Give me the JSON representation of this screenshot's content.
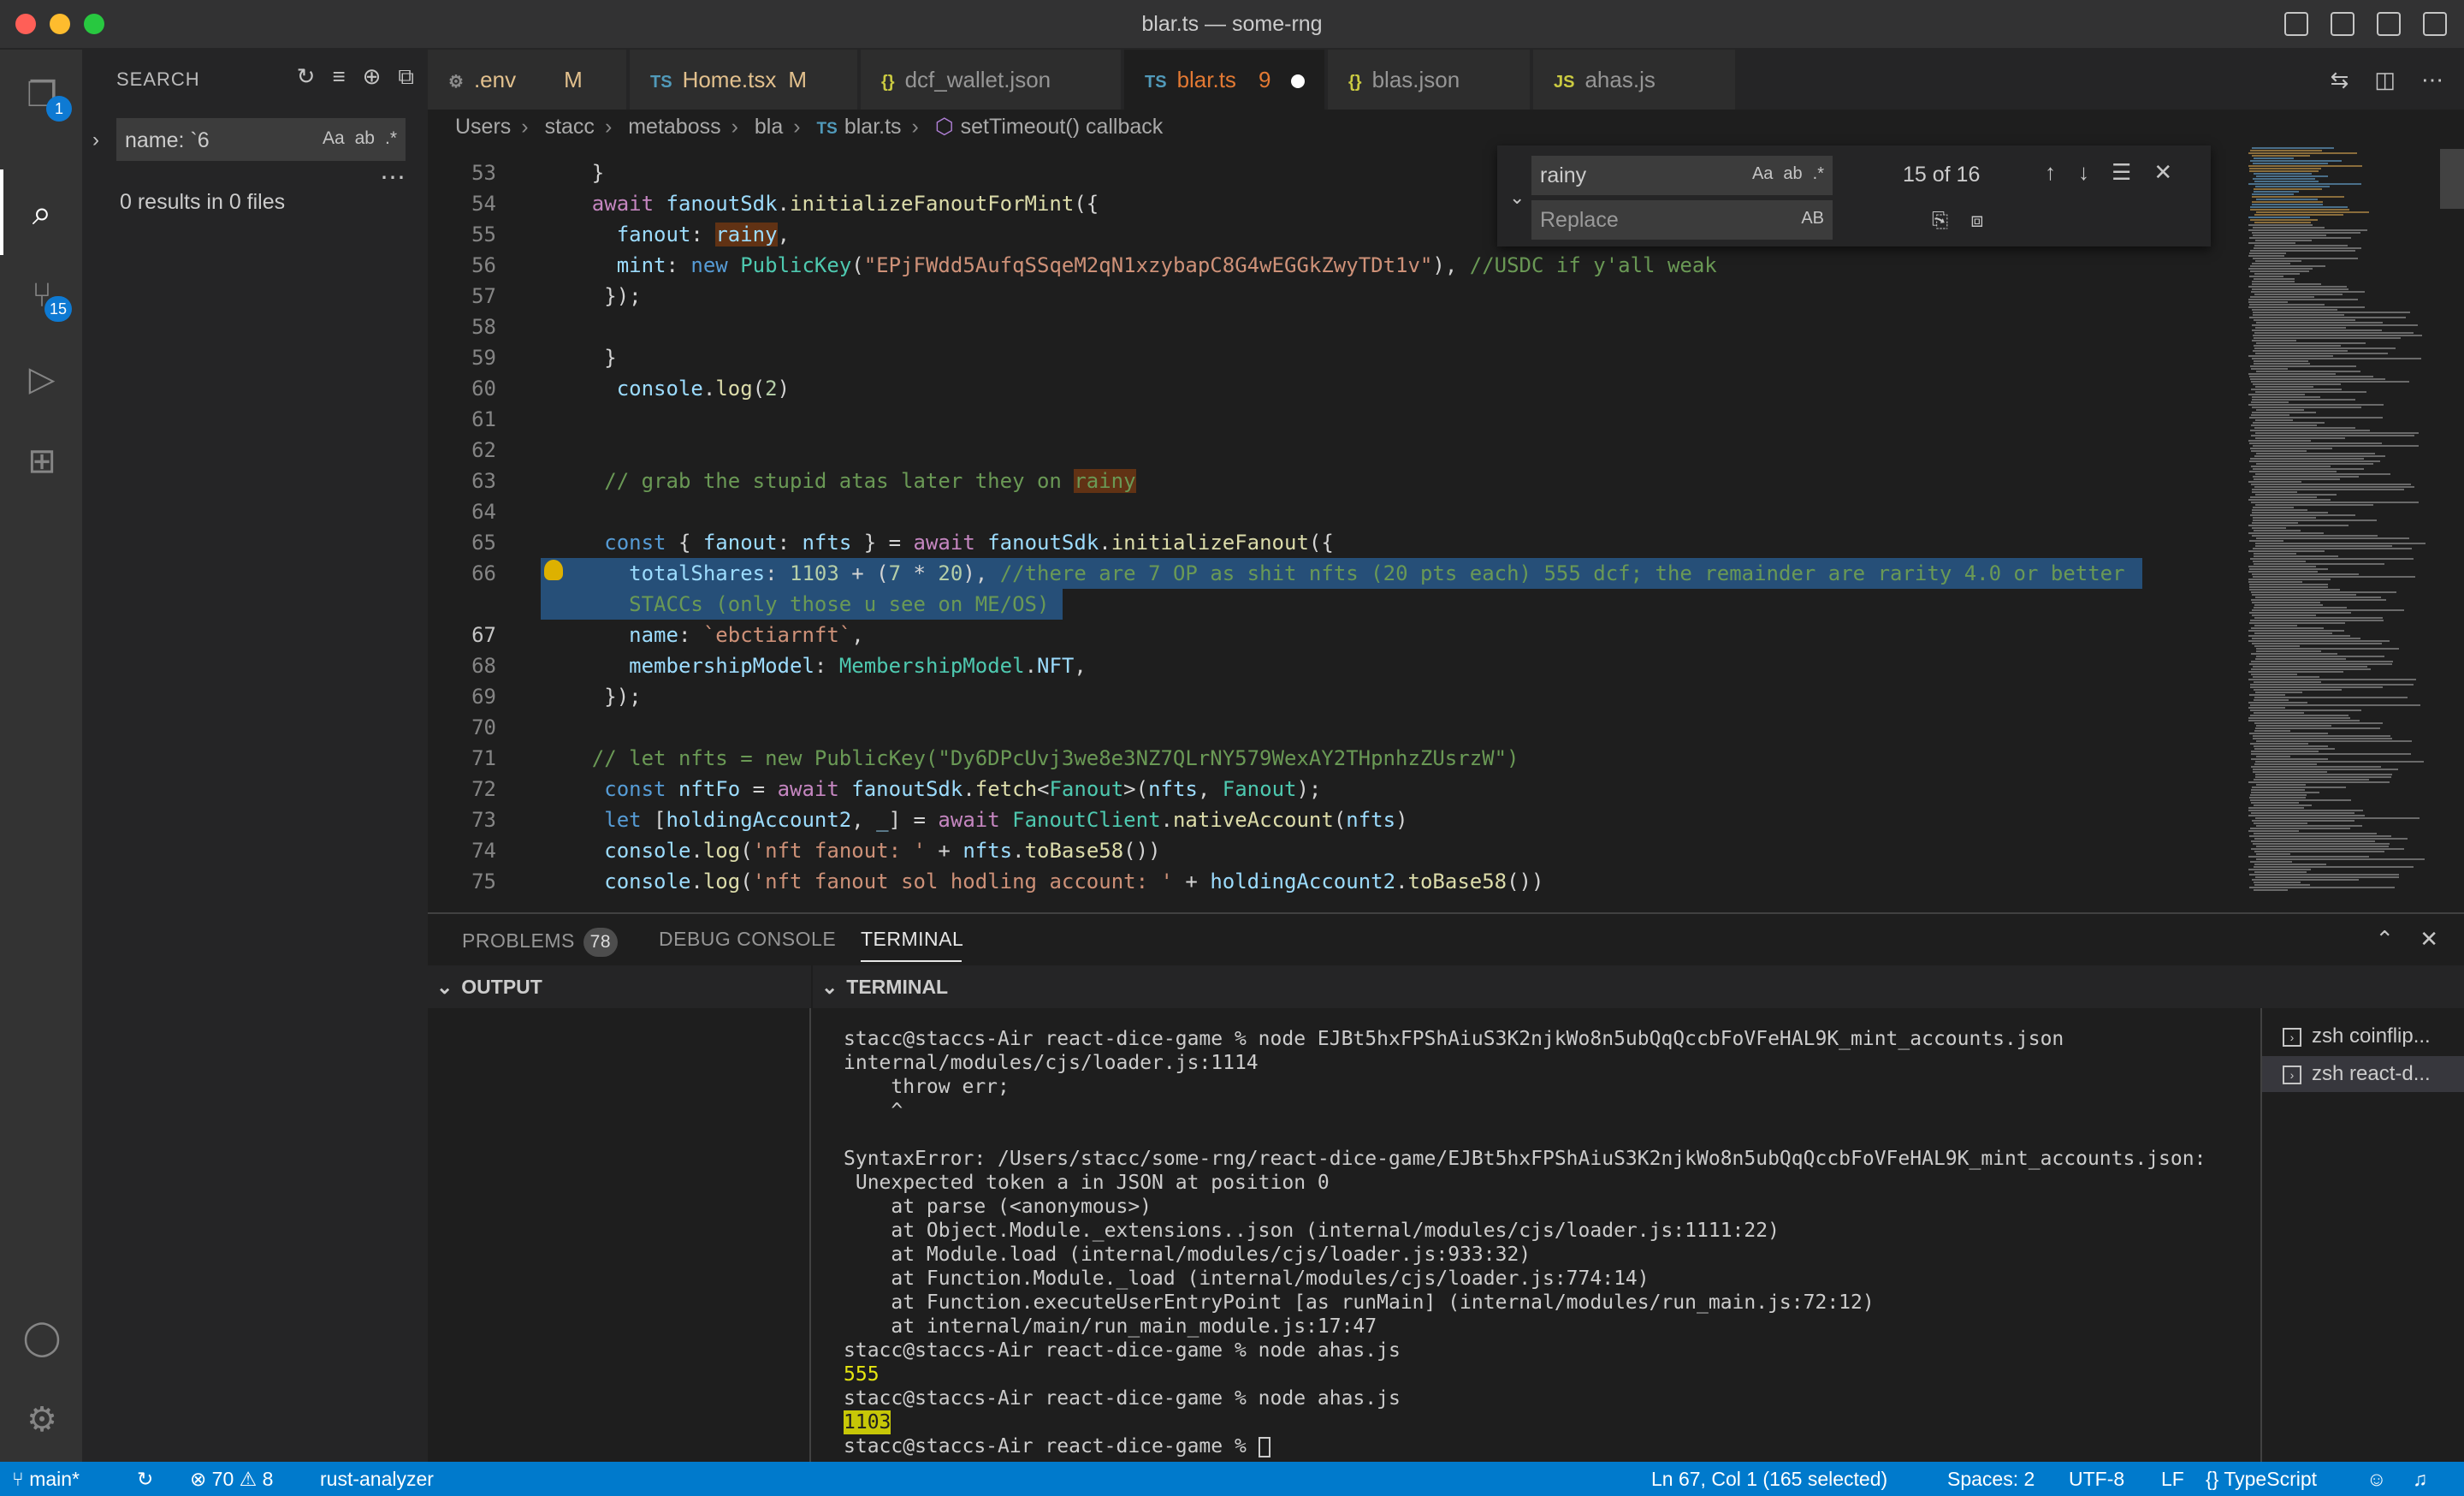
{
  "window": {
    "title": "blar.ts — some-rng"
  },
  "activity": {
    "explorer_badge": "1",
    "scm_badge": "15"
  },
  "sidebar": {
    "title": "SEARCH",
    "search_value": "name: `6",
    "opt_case": "Aa",
    "opt_word": "ab",
    "opt_regex": ".*",
    "results": "0 results in 0 files"
  },
  "tabs": [
    {
      "icon": "⚙",
      "label": ".env",
      "marker": "M",
      "color": "#e2c08d"
    },
    {
      "icon": "TS",
      "label": "Home.tsx",
      "marker": "M",
      "color": "#e2c08d"
    },
    {
      "icon": "{}",
      "label": "dcf_wallet.json",
      "marker": "",
      "color": "#969696"
    },
    {
      "icon": "TS",
      "label": "blar.ts",
      "marker": "9",
      "color": "#e37933"
    },
    {
      "icon": "{}",
      "label": "blas.json",
      "marker": "",
      "color": "#969696"
    },
    {
      "icon": "JS",
      "label": "ahas.js",
      "marker": "",
      "color": "#969696"
    }
  ],
  "breadcrumb": [
    "Users",
    "stacc",
    "metaboss",
    "bla",
    "blar.ts",
    "setTimeout() callback"
  ],
  "find": {
    "search": "rainy",
    "count": "15 of 16",
    "replace_placeholder": "Replace",
    "opt_case": "Aa",
    "opt_word": "ab",
    "opt_regex": ".*",
    "opt_preserve": "AB"
  },
  "code_lines": [
    {
      "n": "53",
      "h": "    }"
    },
    {
      "n": "54",
      "h": "    <span class=\"kw2\">await</span> <span class=\"var\">fanoutSdk</span>.<span class=\"fn\">initializeFanoutForMint</span>({"
    },
    {
      "n": "55",
      "h": "      <span class=\"var\">fanout</span>: <span class=\"var hl\">rainy</span>,"
    },
    {
      "n": "56",
      "h": "      <span class=\"var\">mint</span>: <span class=\"kw\">new</span> <span class=\"cls\">PublicKey</span>(<span class=\"str\">\"EPjFWdd5AufqSSqeM2qN1xzybapC8G4wEGGkZwyTDt1v\"</span>), <span class=\"cm\">//USDC if y'all weak</span>"
    },
    {
      "n": "57",
      "h": "     });"
    },
    {
      "n": "58",
      "h": ""
    },
    {
      "n": "59",
      "h": "     }"
    },
    {
      "n": "60",
      "h": "      <span class=\"var\">console</span>.<span class=\"fn\">log</span>(<span class=\"num\">2</span>)"
    },
    {
      "n": "61",
      "h": ""
    },
    {
      "n": "62",
      "h": ""
    },
    {
      "n": "63",
      "h": "     <span class=\"cm\">// grab the stupid atas later they on </span><span class=\"cm hl\">rainy</span>"
    },
    {
      "n": "64",
      "h": ""
    },
    {
      "n": "65",
      "h": "     <span class=\"kw\">const</span> { <span class=\"var\">fanout</span>: <span class=\"var\">nfts</span> } = <span class=\"kw2\">await</span> <span class=\"var\">fanoutSdk</span>.<span class=\"fn\">initializeFanout</span>({"
    },
    {
      "n": "66",
      "h": "       <span class=\"var\">totalShares</span>: <span class=\"num\">1103</span> + (<span class=\"num\">7</span> * <span class=\"num\">20</span>), <span class=\"cm\">//there are 7 OP as shit nfts (20 pts each) 555 dcf; the remainder are rarity 4.0 or better</span>"
    },
    {
      "n": "",
      "h": "       <span class=\"cm\">STACCs (only those u see on ME/OS)</span>"
    },
    {
      "n": "67",
      "h": "       <span class=\"var\">name</span>: <span class=\"str\">`ebctiarnft`</span>,"
    },
    {
      "n": "68",
      "h": "       <span class=\"var\">membershipModel</span>: <span class=\"cls\">MembershipModel</span>.<span class=\"var\">NFT</span>,"
    },
    {
      "n": "69",
      "h": "     });"
    },
    {
      "n": "70",
      "h": ""
    },
    {
      "n": "71",
      "h": "    <span class=\"cm\">// let nfts = new PublicKey(\"Dy6DPcUvj3we8e3NZ7QLrNY579WexAY2THpnhzZUsrzW\")</span>"
    },
    {
      "n": "72",
      "h": "     <span class=\"kw\">const</span> <span class=\"var\">nftFo</span> = <span class=\"kw2\">await</span> <span class=\"var\">fanoutSdk</span>.<span class=\"fn\">fetch</span>&lt;<span class=\"cls\">Fanout</span>&gt;(<span class=\"var\">nfts</span>, <span class=\"cls\">Fanout</span>);"
    },
    {
      "n": "73",
      "h": "     <span class=\"kw\">let</span> [<span class=\"var\">holdingAccount2</span>, <span class=\"var\">_</span>] = <span class=\"kw2\">await</span> <span class=\"cls\">FanoutClient</span>.<span class=\"fn\">nativeAccount</span>(<span class=\"var\">nfts</span>)"
    },
    {
      "n": "74",
      "h": "     <span class=\"var\">console</span>.<span class=\"fn\">log</span>(<span class=\"str\">'nft fanout: '</span> + <span class=\"var\">nfts</span>.<span class=\"fn\">toBase58</span>())"
    },
    {
      "n": "75",
      "h": "     <span class=\"var\">console</span>.<span class=\"fn\">log</span>(<span class=\"str\">'nft fanout sol hodling account: '</span> + <span class=\"var\">holdingAccount2</span>.<span class=\"fn\">toBase58</span>())"
    }
  ],
  "panel": {
    "problems": "PROBLEMS",
    "problems_count": "78",
    "debug": "DEBUG CONSOLE",
    "terminal": "TERMINAL",
    "output_header": "OUTPUT",
    "terminal_header": "TERMINAL"
  },
  "terminal_lines": [
    {
      "t": "stacc@staccs-Air react-dice-game % node EJBt5hxFPShAiuS3K2njkWo8n5ubQqQccbFoVFeHAL9K_mint_accounts.json",
      "c": ""
    },
    {
      "t": "internal/modules/cjs/loader.js:1114",
      "c": ""
    },
    {
      "t": "    throw err;",
      "c": ""
    },
    {
      "t": "    ^",
      "c": ""
    },
    {
      "t": "",
      "c": ""
    },
    {
      "t": "SyntaxError: /Users/stacc/some-rng/react-dice-game/EJBt5hxFPShAiuS3K2njkWo8n5ubQqQccbFoVFeHAL9K_mint_accounts.json:",
      "c": ""
    },
    {
      "t": " Unexpected token a in JSON at position 0",
      "c": ""
    },
    {
      "t": "    at parse (<anonymous>)",
      "c": ""
    },
    {
      "t": "    at Object.Module._extensions..json (internal/modules/cjs/loader.js:1111:22)",
      "c": ""
    },
    {
      "t": "    at Module.load (internal/modules/cjs/loader.js:933:32)",
      "c": ""
    },
    {
      "t": "    at Function.Module._load (internal/modules/cjs/loader.js:774:14)",
      "c": ""
    },
    {
      "t": "    at Function.executeUserEntryPoint [as runMain] (internal/modules/run_main.js:72:12)",
      "c": ""
    },
    {
      "t": "    at internal/main/run_main_module.js:17:47",
      "c": ""
    },
    {
      "t": "stacc@staccs-Air react-dice-game % node ahas.js",
      "c": ""
    },
    {
      "t": "555",
      "c": "y"
    },
    {
      "t": "stacc@staccs-Air react-dice-game % node ahas.js",
      "c": ""
    },
    {
      "t": "1103",
      "c": "hy"
    },
    {
      "t": "stacc@staccs-Air react-dice-game % ",
      "c": "prompt"
    }
  ],
  "terminal_list": [
    {
      "label": "zsh  coinflip..."
    },
    {
      "label": "zsh  react-d..."
    }
  ],
  "status": {
    "branch": "main*",
    "errors": "70",
    "warnings": "8",
    "rust": "rust-analyzer",
    "position": "Ln 67, Col 1 (165 selected)",
    "spaces": "Spaces: 2",
    "encoding": "UTF-8",
    "eol": "LF",
    "language": "TypeScript"
  }
}
